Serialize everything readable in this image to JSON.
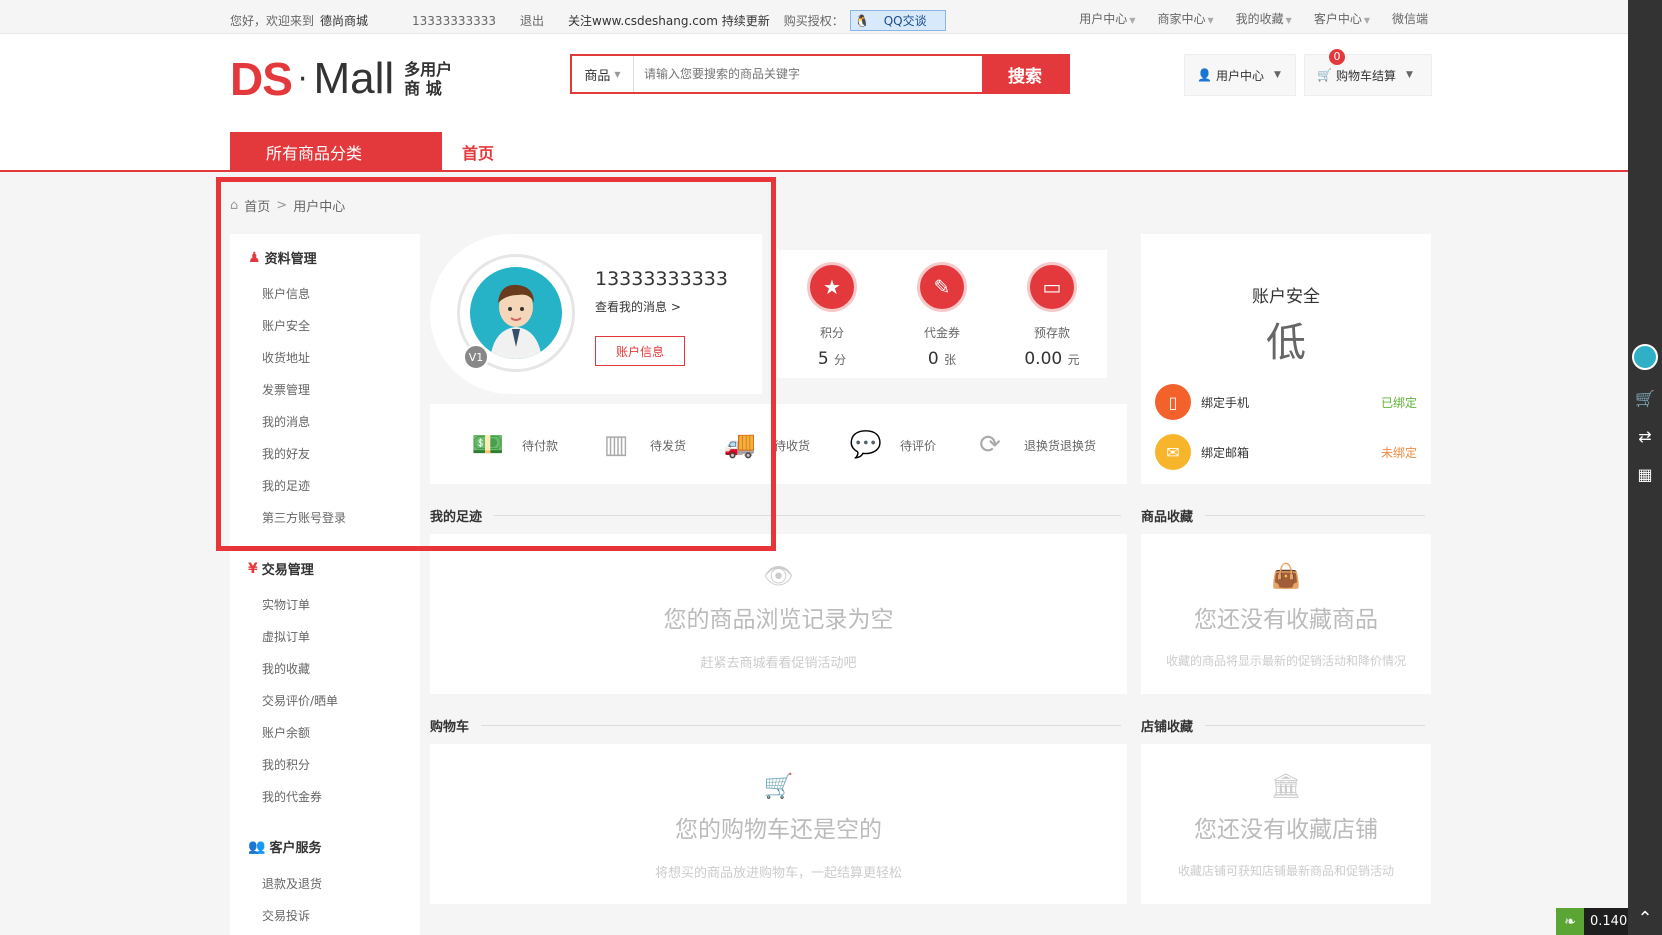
{
  "topbar": {
    "greeting": "您好，欢迎来到",
    "site_name": "德尚商城",
    "phone": "13333333333",
    "logout": "退出",
    "follow": "关注www.csdeshang.com 持续更新",
    "buy": "购买授权：",
    "qq": "QQ交谈",
    "links": [
      "用户中心",
      "商家中心",
      "我的收藏",
      "客户中心",
      "微信端"
    ]
  },
  "logo": {
    "ds": "DS",
    "dot": "·",
    "mall": "Mall",
    "sub1": "多用户",
    "sub2": "商 城"
  },
  "search": {
    "category": "商品",
    "placeholder": "请输入您要搜索的商品关键字",
    "button": "搜索"
  },
  "header": {
    "user_center": "用户中心",
    "cart": "购物车结算",
    "cart_count": "0"
  },
  "nav": {
    "all_categories": "所有商品分类",
    "home": "首页"
  },
  "breadcrumb": {
    "home": "首页",
    "sep": ">",
    "current": "用户中心"
  },
  "sidebar": {
    "groups": [
      {
        "title": "资料管理",
        "items": [
          "账户信息",
          "账户安全",
          "收货地址",
          "发票管理",
          "我的消息",
          "我的好友",
          "我的足迹",
          "第三方账号登录"
        ]
      },
      {
        "title": "交易管理",
        "items": [
          "实物订单",
          "虚拟订单",
          "我的收藏",
          "交易评价/晒单",
          "账户余额",
          "我的积分",
          "我的代金券"
        ]
      },
      {
        "title": "客户服务",
        "items": [
          "退款及退货",
          "交易投诉"
        ]
      }
    ]
  },
  "profile": {
    "level": "V1",
    "username": "13333333333",
    "messages_link": "查看我的消息",
    "messages_arrow": ">",
    "account_button": "账户信息"
  },
  "stats": [
    {
      "label": "积分",
      "value": "5",
      "unit": "分"
    },
    {
      "label": "代金券",
      "value": "0",
      "unit": "张"
    },
    {
      "label": "预存款",
      "value": "0.00",
      "unit": "元"
    }
  ],
  "orders": [
    "待付款",
    "待发货",
    "待收货",
    "待评价",
    "退换货退换货"
  ],
  "security": {
    "title": "账户安全",
    "level": "低",
    "phone_label": "绑定手机",
    "phone_status": "已绑定",
    "email_label": "绑定邮箱",
    "email_status": "未绑定",
    "colors": {
      "bound": "#5fb336",
      "unbound": "#f08b3e"
    }
  },
  "sections": {
    "footprint": {
      "title": "我的足迹",
      "empty": "您的商品浏览记录为空",
      "hint": "赶紧去商城看看促销活动吧"
    },
    "fav_goods": {
      "title": "商品收藏",
      "empty": "您还没有收藏商品",
      "hint": "收藏的商品将显示最新的促销活动和降价情况"
    },
    "cart": {
      "title": "购物车",
      "empty": "您的购物车还是空的",
      "hint": "将想买的商品放进购物车，一起结算更轻松"
    },
    "fav_stores": {
      "title": "店铺收藏",
      "empty": "您还没有收藏店铺",
      "hint": "收藏店铺可获知店铺最新商品和促销活动"
    }
  },
  "version": "0.140",
  "colors": {
    "accent": "#e4393c"
  }
}
